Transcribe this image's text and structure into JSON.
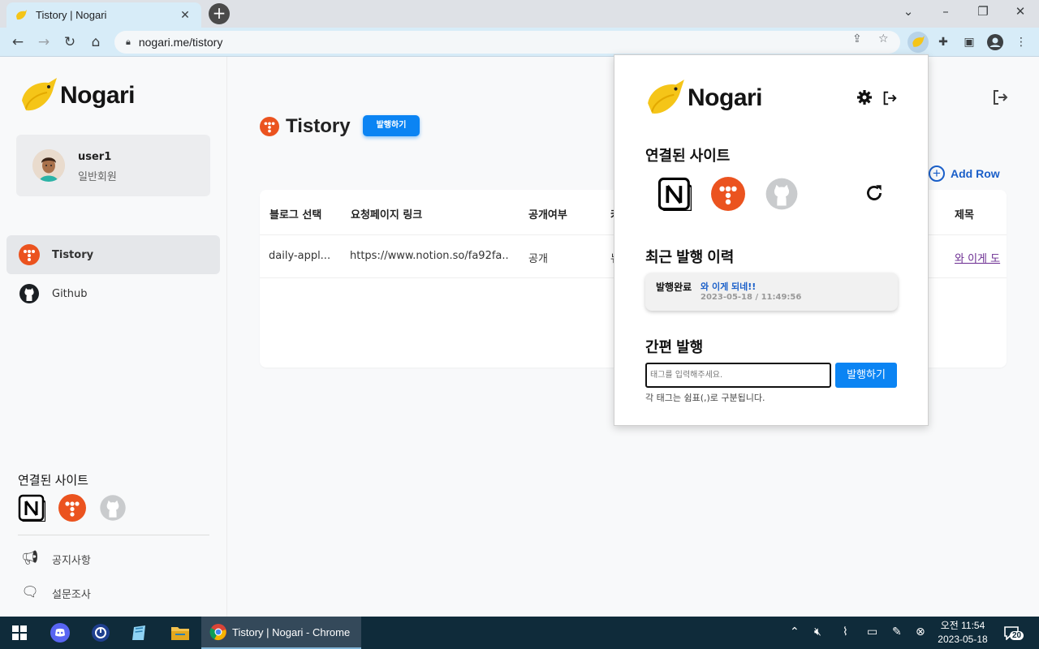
{
  "browser": {
    "tab_title": "Tistory | Nogari",
    "tab_close": "✕",
    "new_tab": "+",
    "url": "nogari.me/tistory"
  },
  "sidebar": {
    "logo_text": "Nogari",
    "user": {
      "name": "user1",
      "role": "일반회원"
    },
    "nav": [
      {
        "label": "Tistory",
        "icon": "tistory-icon",
        "active": true
      },
      {
        "label": "Github",
        "icon": "github-icon",
        "active": false
      }
    ],
    "linked_sites_title": "연결된 사이트",
    "linked_sites": [
      "notion-icon",
      "tistory-icon",
      "github-icon"
    ],
    "footer": [
      {
        "label": "공지사항",
        "icon": "megaphone-icon"
      },
      {
        "label": "설문조사",
        "icon": "survey-icon"
      }
    ]
  },
  "main": {
    "title": "Tistory",
    "publish_button": "발행하기",
    "add_row": "Add Row",
    "table": {
      "headers": [
        "블로그 선택",
        "요청페이지 링크",
        "공개여부",
        "카",
        "제목"
      ],
      "rows": [
        {
          "blog": "daily-appl...",
          "link": "https://www.notion.so/fa92fa...",
          "visibility": "공개",
          "category": "뉴",
          "title": "와 이게 도"
        }
      ]
    }
  },
  "popup": {
    "logo_text": "Nogari",
    "linked_sites_title": "연결된 사이트",
    "recent_title": "최근 발행 이력",
    "history": [
      {
        "status": "발행완료",
        "title": "와 이게 되네!!",
        "date": "2023-05-18 / 11:49:56"
      }
    ],
    "quick_title": "간편 발행",
    "tag_placeholder": "태그를 입력해주세요.",
    "publish_button": "발행하기",
    "hint": "각 태그는 쉼표(,)로 구분됩니다."
  },
  "taskbar": {
    "chrome_label": "Tistory | Nogari - Chrome",
    "time": "오전 11:54",
    "date": "2023-05-18",
    "notifications": "20"
  },
  "colors": {
    "accent": "#0b84f3",
    "tistory": "#eb531f",
    "logo_yellow": "#f5c518"
  }
}
